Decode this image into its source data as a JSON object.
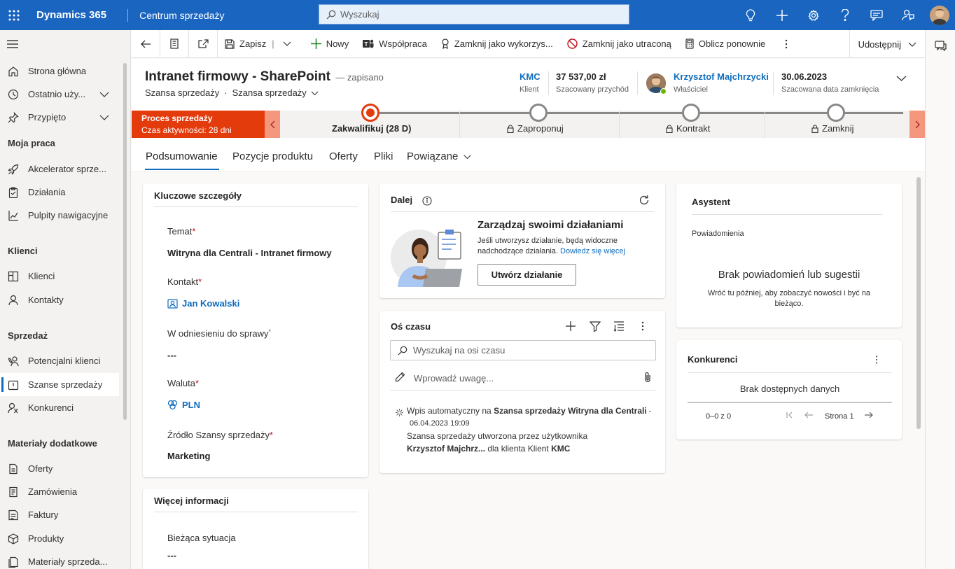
{
  "topbar": {
    "brand": "Dynamics 365",
    "app": "Centrum sprzedaży",
    "search_placeholder": "Wyszukaj"
  },
  "nav": {
    "items": [
      {
        "label": "Strona główna",
        "icon": "home-icon"
      },
      {
        "label": "Ostatnio uży...",
        "icon": "clock-icon"
      },
      {
        "label": "Przypięto",
        "icon": "pin-icon"
      },
      {
        "label": "Akcelerator sprze...",
        "icon": "rocket-icon"
      },
      {
        "label": "Działania",
        "icon": "clipboard-icon"
      },
      {
        "label": "Pulpity nawigacyjne",
        "icon": "dashboard-icon"
      },
      {
        "label": "Klienci",
        "icon": "building-icon"
      },
      {
        "label": "Kontakty",
        "icon": "person-icon"
      },
      {
        "label": "Potencjalni klienci",
        "icon": "phone-person-icon"
      },
      {
        "label": "Szanse sprzedaży",
        "icon": "opportunity-icon"
      },
      {
        "label": "Konkurenci",
        "icon": "competitor-icon"
      },
      {
        "label": "Oferty",
        "icon": "document-icon"
      },
      {
        "label": "Zamówienia",
        "icon": "order-icon"
      },
      {
        "label": "Faktury",
        "icon": "invoice-icon"
      },
      {
        "label": "Produkty",
        "icon": "cube-icon"
      },
      {
        "label": "Materiały sprzeda...",
        "icon": "materials-icon"
      }
    ],
    "groups": {
      "work": "Moja praca",
      "customers": "Klienci",
      "sales": "Sprzedaż",
      "collateral": "Materiały dodatkowe"
    }
  },
  "commands": {
    "save": "Zapisz",
    "new": "Nowy",
    "collab": "Współpraca",
    "close_won": "Zamknij jako wykorzys...",
    "close_lost": "Zamknij jako utraconą",
    "recalc": "Oblicz ponownie",
    "share": "Udostępnij"
  },
  "header": {
    "title": "Intranet firmowy - SharePoint",
    "saved": "— zapisano",
    "entity": "Szansa sprzedaży",
    "form": "Szansa sprzedaży",
    "account_value": "KMC",
    "account_label": "Klient",
    "revenue_value": "37 537,00 zł",
    "revenue_label": "Szacowany przychód",
    "owner_value": "Krzysztof Majchrzycki",
    "owner_label": "Właściciel",
    "close_value": "30.06.2023",
    "close_label": "Szacowana data zamknięcia"
  },
  "bpf": {
    "active_title": "Proces sprzedaży",
    "active_sub": "Czas aktywności: 28 dni",
    "stages": [
      {
        "label": "Zakwalifikuj  (28 D)",
        "current": true
      },
      {
        "label": "Zaproponuj",
        "locked": true
      },
      {
        "label": "Kontrakt",
        "locked": true
      },
      {
        "label": "Zamknij",
        "locked": true
      }
    ]
  },
  "tabs": [
    "Podsumowanie",
    "Pozycje produktu",
    "Oferty",
    "Pliki",
    "Powiązane"
  ],
  "key_details": {
    "title": "Kluczowe szczegóły",
    "topic_label": "Temat",
    "topic_value": "Witryna dla Centrali - Intranet firmowy",
    "contact_label": "Kontakt",
    "contact_value": "Jan Kowalski",
    "case_label": "W odniesieniu do sprawy",
    "case_value": "---",
    "currency_label": "Waluta",
    "currency_value": "PLN",
    "source_label": "Źródło Szansy sprzedaży",
    "source_value": "Marketing"
  },
  "more_info": {
    "title": "Więcej informacji",
    "situation_label": "Bieżąca sytuacja",
    "situation_value": "---"
  },
  "next": {
    "title": "Dalej",
    "heading": "Zarządzaj swoimi działaniami",
    "text1": "Jeśli utworzysz działanie, będą widoczne",
    "text2": "nadchodzące działania.",
    "link": "Dowiedz się więcej",
    "button": "Utwórz działanie"
  },
  "timeline": {
    "title": "Oś czasu",
    "search_placeholder": "Wyszukaj na osi czasu",
    "note_placeholder": "Wprowadź uwagę...",
    "post_prefix": "Wpis automatyczny na ",
    "post_entity": "Szansa sprzedaży Witryna dla Centrali - I",
    "post_date": "06.04.2023 19:09",
    "post_line1": "Szansa sprzedaży utworzona przez użytkownika",
    "post_user": "Krzysztof Majchrz...",
    "post_mid": " dla klienta Klient ",
    "post_client": "KMC"
  },
  "assistant": {
    "title": "Asystent",
    "notifications": "Powiadomienia",
    "empty_title": "Brak powiadomień lub sugestii",
    "empty_line1": "Wróć tu później, aby zobaczyć nowości i być na",
    "empty_line2": "bieżąco."
  },
  "competitors": {
    "title": "Konkurenci",
    "empty": "Brak dostępnych danych",
    "count": "0–0 z 0",
    "page": "Strona 1"
  },
  "colors": {
    "brand_blue": "#1a65c0",
    "accent": "#0f6cbd",
    "bpf_active": "#e43b0c"
  }
}
